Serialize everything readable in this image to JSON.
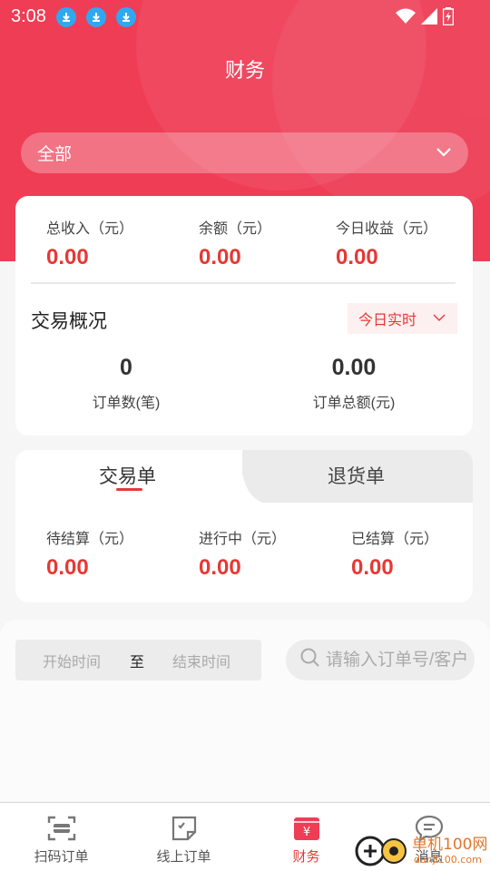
{
  "status_bar": {
    "time": "3:08"
  },
  "header": {
    "title": "财务"
  },
  "selector": {
    "value": "全部"
  },
  "summary": {
    "items": [
      {
        "label": "总收入（元）",
        "value": "0.00"
      },
      {
        "label": "余额（元）",
        "value": "0.00"
      },
      {
        "label": "今日收益（元）",
        "value": "0.00"
      }
    ]
  },
  "overview": {
    "title": "交易概况",
    "range": "今日实时",
    "order_count": {
      "value": "0",
      "label": "订单数(笔)"
    },
    "order_total": {
      "value": "0.00",
      "label": "订单总额(元)"
    }
  },
  "tabs": {
    "active": "交易单",
    "inactive": "退货单"
  },
  "settlement": {
    "items": [
      {
        "label": "待结算（元）",
        "value": "0.00"
      },
      {
        "label": "进行中（元）",
        "value": "0.00"
      },
      {
        "label": "已结算（元）",
        "value": "0.00"
      }
    ]
  },
  "filter": {
    "start_placeholder": "开始时间",
    "separator": "至",
    "end_placeholder": "结束时间",
    "search_placeholder": "请输入订单号/客户"
  },
  "tabbar": {
    "items": [
      {
        "label": "扫码订单",
        "icon": "scan-icon"
      },
      {
        "label": "线上订单",
        "icon": "note-icon"
      },
      {
        "label": "财务",
        "icon": "yen-wallet-icon"
      },
      {
        "label": "消息",
        "icon": "chat-icon"
      }
    ]
  },
  "watermark": {
    "text": "单机100网",
    "sub": "danji100.com"
  },
  "colors": {
    "brand": "#ee3d55",
    "accent_text": "#e53935"
  }
}
